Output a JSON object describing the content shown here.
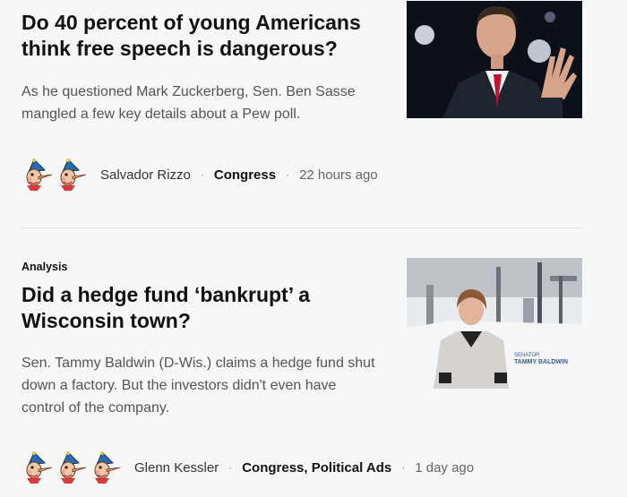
{
  "articles": [
    {
      "kicker": "",
      "headline": "Do 40 percent of young Americans think free speech is dangerous?",
      "blurb": "As he questioned Mark Zuckerberg, Sen. Ben Sasse mangled a few key details about a Pew poll.",
      "pinocchios": 2,
      "author": "Salvador Rizzo",
      "section": "Congress",
      "time": "22 hours ago",
      "photo": {
        "subject": "man in suit speaking at podium",
        "tie_color": "#c8102e"
      }
    },
    {
      "kicker": "Analysis",
      "headline": "Did a hedge fund ‘bankrupt’ a Wisconsin town?",
      "blurb": "Sen. Tammy Baldwin (D-Wis.) claims a hedge fund shut down a factory. But the investors didn't even have control of the company.",
      "pinocchios": 3,
      "author": "Glenn Kessler",
      "section": "Congress, Political Ads",
      "time": "1 day ago",
      "photo": {
        "caption_line1": "SENATOR",
        "caption_line2": "TAMMY BALDWIN"
      }
    }
  ],
  "separator": "·",
  "icons": {
    "rating": "pinocchio-icon"
  }
}
